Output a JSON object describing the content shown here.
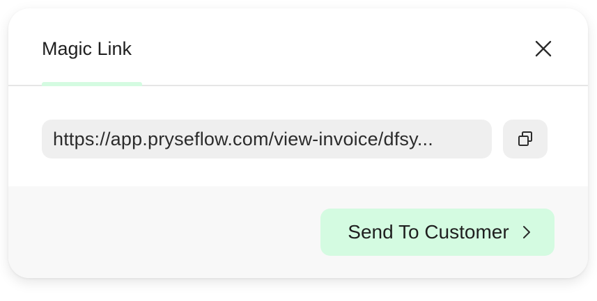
{
  "modal": {
    "tab_label": "Magic Link",
    "close_icon": "close-icon"
  },
  "link": {
    "value": "https://app.pryseflow.com/view-invoice/dfsy...",
    "copy_icon": "copy-icon"
  },
  "footer": {
    "send_label": "Send To Customer",
    "send_icon": "chevron-right-icon"
  },
  "colors": {
    "accent": "#d4fbe1",
    "surface": "#efefef",
    "footer_bg": "#f8f8f8",
    "text": "#1f1f1f"
  }
}
